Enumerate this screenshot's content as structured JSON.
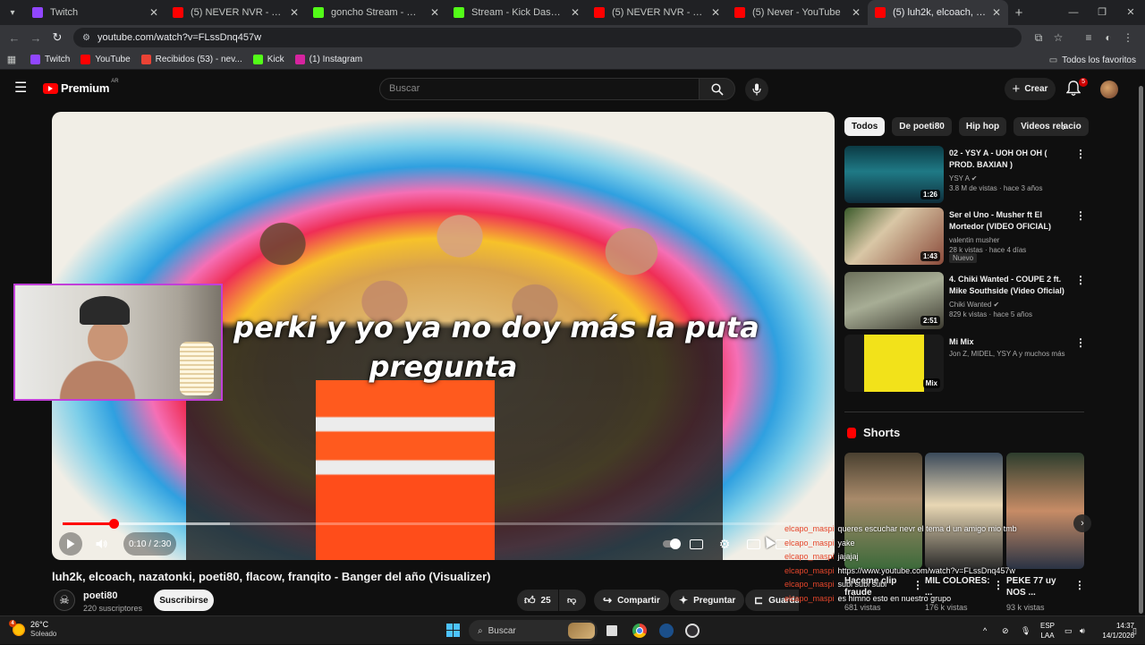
{
  "browser": {
    "tabs": [
      {
        "title": "Twitch",
        "favicon": "twitch-icon",
        "color": "#9146ff",
        "active": false
      },
      {
        "title": "(5) NEVER NVR - YouTube",
        "favicon": "youtube-icon",
        "color": "#ff0000",
        "active": false
      },
      {
        "title": "goncho Stream - Watch Live on",
        "favicon": "kick-icon",
        "color": "#53fc18",
        "active": false
      },
      {
        "title": "Stream - Kick Dashboard",
        "favicon": "kick-icon",
        "color": "#53fc18",
        "active": false
      },
      {
        "title": "(5) NEVER NVR - YouTube",
        "favicon": "youtube-icon",
        "color": "#ff0000",
        "active": false
      },
      {
        "title": "(5) Never - YouTube",
        "favicon": "youtube-icon",
        "color": "#ff0000",
        "active": false
      },
      {
        "title": "(5) luh2k, elcoach, nazatonki, p",
        "favicon": "youtube-icon",
        "color": "#ff0000",
        "active": true
      }
    ],
    "url": "youtube.com/watch?v=FLssDnq457w",
    "bookmarks": [
      {
        "label": "Twitch",
        "color": "#9146ff",
        "icon": "twitch-icon"
      },
      {
        "label": "YouTube",
        "color": "#ff0000",
        "icon": "youtube-icon"
      },
      {
        "label": "Recibidos (53) - nev...",
        "color": "#ea4335",
        "icon": "gmail-icon"
      },
      {
        "label": "Kick",
        "color": "#53fc18",
        "icon": "kick-icon"
      },
      {
        "label": "(1) Instagram",
        "color": "#d6249f",
        "icon": "instagram-icon"
      }
    ],
    "all_bookmarks": "Todos los favoritos"
  },
  "youtube": {
    "logo": "Premium",
    "region": "AR",
    "search_placeholder": "Buscar",
    "create_label": "Crear",
    "notifications": "5",
    "player": {
      "lyric_line1": "tiro la perki y yo ya no doy más la puta",
      "lyric_line2": "pregunta",
      "time": "0:10 / 2:30",
      "progress": 0.067,
      "buffered": 0.22
    },
    "video": {
      "title": "luh2k, elcoach, nazatonki, poeti80, flacow, franqito - Banger del año (Visualizer)",
      "channel": "poeti80",
      "subscribers": "220 suscriptores",
      "subscribe": "Suscribirse",
      "likes": "25",
      "share": "Compartir",
      "ask": "Preguntar",
      "save": "Guardar"
    },
    "chips": [
      "Todos",
      "De poeti80",
      "Hip hop",
      "Videos relacio"
    ],
    "recommendations": [
      {
        "title": "02 - YSY A - UOH OH OH ( PROD. BAXIAN )",
        "channel": "YSY A",
        "meta": "3.8 M de vistas · hace 3 años",
        "duration": "1:26",
        "verified": true
      },
      {
        "title": "Ser el Uno - Musher ft El Mortedor (VIDEO OFICIAL)",
        "channel": "valentin musher",
        "meta": "28 k vistas · hace 4 días",
        "duration": "1:43",
        "badge": "Nuevo"
      },
      {
        "title": "4. Chiki Wanted - COUPE 2 ft. Mike Southside (Video Oficial)",
        "channel": "Chiki Wanted",
        "meta": "829 k vistas · hace 5 años",
        "duration": "2:51",
        "verified": true
      },
      {
        "title": "Mi Mix",
        "channel": "Jon Z, MIDEL, YSY A y muchos más",
        "meta": "",
        "duration": "Mix"
      }
    ],
    "shorts_title": "Shorts",
    "shorts": [
      {
        "title": "Haceme clip fraude",
        "views": "681 vistas"
      },
      {
        "title": "MIL COLORES: ...",
        "views": "176 k vistas"
      },
      {
        "title": "PEKE 77 uy NOS ...",
        "views": "93 k vistas"
      }
    ],
    "chat": [
      {
        "user": "elcapo_maspi",
        "msg": "queres escuchar nevr el tema d un amigo mio tmb"
      },
      {
        "user": "elcapo_maspi",
        "msg": "yake"
      },
      {
        "user": "elcapo_maspi",
        "msg": "jajajaj"
      },
      {
        "user": "elcapo_maspi",
        "msg": "https://www.youtube.com/watch?v=FLssDnq457w"
      },
      {
        "user": "elcapo_maspi",
        "msg": "subi subi subi"
      },
      {
        "user": "elcapo_maspi",
        "msg": "es himno esto en nuestro grupo"
      }
    ]
  },
  "taskbar": {
    "temp": "26°C",
    "weather": "Soleado",
    "weather_badge": "4",
    "search": "Buscar",
    "lang1": "ESP",
    "lang2": "LAA",
    "time": "14:37",
    "date": "14/1/2026"
  }
}
